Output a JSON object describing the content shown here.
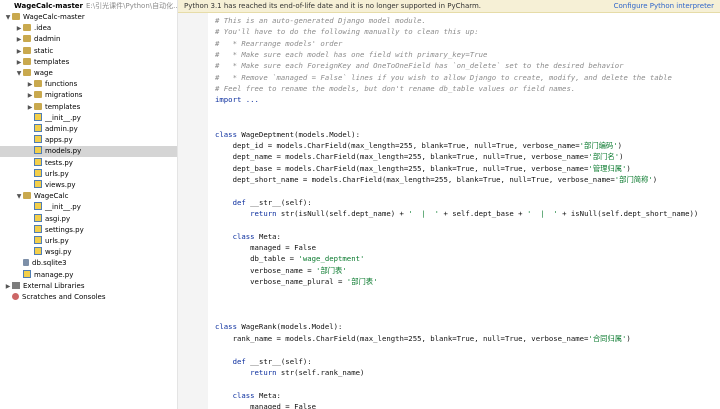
{
  "sidebar": {
    "project_name": "WageCalc-master",
    "project_path": "E:\\引光课件\\Python\\自动化...",
    "items": [
      {
        "label": "WageCalc-master",
        "level": 0,
        "type": "folder",
        "expanded": true,
        "icon": "folder-icon"
      },
      {
        "label": ".idea",
        "level": 1,
        "type": "folder",
        "expanded": false,
        "icon": "folder-icon"
      },
      {
        "label": "dadmin",
        "level": 1,
        "type": "folder",
        "expanded": false,
        "icon": "folder-icon"
      },
      {
        "label": "static",
        "level": 1,
        "type": "folder",
        "expanded": false,
        "icon": "folder-icon"
      },
      {
        "label": "templates",
        "level": 1,
        "type": "folder",
        "expanded": false,
        "icon": "folder-icon"
      },
      {
        "label": "wage",
        "level": 1,
        "type": "folder",
        "expanded": true,
        "icon": "folder-icon"
      },
      {
        "label": "functions",
        "level": 2,
        "type": "folder",
        "expanded": false,
        "icon": "folder-icon"
      },
      {
        "label": "migrations",
        "level": 2,
        "type": "folder",
        "expanded": false,
        "icon": "folder-icon"
      },
      {
        "label": "templates",
        "level": 2,
        "type": "folder",
        "expanded": false,
        "icon": "folder-icon"
      },
      {
        "label": "__init__.py",
        "level": 2,
        "type": "py",
        "icon": "python-file-icon"
      },
      {
        "label": "admin.py",
        "level": 2,
        "type": "py",
        "icon": "python-file-icon"
      },
      {
        "label": "apps.py",
        "level": 2,
        "type": "py",
        "icon": "python-file-icon"
      },
      {
        "label": "models.py",
        "level": 2,
        "type": "py",
        "icon": "python-file-icon",
        "selected": true
      },
      {
        "label": "tests.py",
        "level": 2,
        "type": "py",
        "icon": "python-file-icon"
      },
      {
        "label": "urls.py",
        "level": 2,
        "type": "py",
        "icon": "python-file-icon"
      },
      {
        "label": "views.py",
        "level": 2,
        "type": "py",
        "icon": "python-file-icon"
      },
      {
        "label": "WageCalc",
        "level": 1,
        "type": "folder",
        "expanded": true,
        "icon": "folder-icon"
      },
      {
        "label": "__init__.py",
        "level": 2,
        "type": "py",
        "icon": "python-file-icon"
      },
      {
        "label": "asgi.py",
        "level": 2,
        "type": "py",
        "icon": "python-file-icon"
      },
      {
        "label": "settings.py",
        "level": 2,
        "type": "py",
        "icon": "python-file-icon"
      },
      {
        "label": "urls.py",
        "level": 2,
        "type": "py",
        "icon": "python-file-icon"
      },
      {
        "label": "wsgi.py",
        "level": 2,
        "type": "py",
        "icon": "python-file-icon"
      },
      {
        "label": "db.sqlite3",
        "level": 1,
        "type": "db",
        "icon": "database-file-icon"
      },
      {
        "label": "manage.py",
        "level": 1,
        "type": "py",
        "icon": "python-file-icon"
      },
      {
        "label": "External Libraries",
        "level": 0,
        "type": "libs",
        "expanded": false,
        "icon": "libraries-icon"
      },
      {
        "label": "Scratches and Consoles",
        "level": 0,
        "type": "scratch",
        "icon": "scratches-icon"
      }
    ]
  },
  "banner": {
    "message": "Python 3.1 has reached its end-of-life date and it is no longer supported in PyCharm.",
    "link": "Configure Python interpreter",
    "bg_color": "#f6f0d6"
  },
  "editor": {
    "lines": [
      [
        [
          "c",
          "# This is an auto-generated Django model module."
        ]
      ],
      [
        [
          "c",
          "# You'll have to do the following manually to clean this up:"
        ]
      ],
      [
        [
          "c",
          "#   * Rearrange models' order"
        ]
      ],
      [
        [
          "c",
          "#   * Make sure each model has one field with primary_key=True"
        ]
      ],
      [
        [
          "c",
          "#   * Make sure each ForeignKey and OneToOneField has `on_delete` set to the desired behavior"
        ]
      ],
      [
        [
          "c",
          "#   * Remove `managed = False` lines if you wish to allow Django to create, modify, and delete the table"
        ]
      ],
      [
        [
          "c",
          "# Feel free to rename the models, but don't rename db_table values or field names."
        ]
      ],
      [
        [
          "k",
          "import ..."
        ]
      ],
      [],
      [],
      [
        [
          "k",
          "class "
        ],
        [
          "t",
          "WageDeptment(models.Model):"
        ]
      ],
      [
        [
          "t",
          "    dept_id = models.CharField(max_length=255, blank=True, null=True, verbose_name="
        ],
        [
          "s",
          "'部门编码'"
        ],
        [
          "t",
          ")"
        ]
      ],
      [
        [
          "t",
          "    dept_name = models.CharField(max_length=255, blank=True, null=True, verbose_name="
        ],
        [
          "s",
          "'部门名'"
        ],
        [
          "t",
          ")"
        ]
      ],
      [
        [
          "t",
          "    dept_base = models.CharField(max_length=255, blank=True, null=True, verbose_name="
        ],
        [
          "s",
          "'管理归属'"
        ],
        [
          "t",
          ")"
        ]
      ],
      [
        [
          "t",
          "    dept_short_name = models.CharField(max_length=255, blank=True, null=True, verbose_name="
        ],
        [
          "s",
          "'部门简称'"
        ],
        [
          "t",
          ")"
        ]
      ],
      [],
      [
        [
          "k",
          "    def "
        ],
        [
          "t",
          "__str__(self):"
        ]
      ],
      [
        [
          "k",
          "        return "
        ],
        [
          "t",
          "str(isNull(self.dept_name) + "
        ],
        [
          "s",
          "'  |  '"
        ],
        [
          "t",
          " + self.dept_base + "
        ],
        [
          "s",
          "'  |  '"
        ],
        [
          "t",
          " + isNull(self.dept_short_name))"
        ]
      ],
      [],
      [
        [
          "k",
          "    class "
        ],
        [
          "t",
          "Meta:"
        ]
      ],
      [
        [
          "t",
          "        managed = False"
        ]
      ],
      [
        [
          "t",
          "        db_table = "
        ],
        [
          "s",
          "'wage_deptment'"
        ]
      ],
      [
        [
          "t",
          "        verbose_name = "
        ],
        [
          "s",
          "'部门表'"
        ]
      ],
      [
        [
          "t",
          "        verbose_name_plural = "
        ],
        [
          "s",
          "'部门表'"
        ]
      ],
      [],
      [],
      [],
      [
        [
          "k",
          "class "
        ],
        [
          "t",
          "WageRank(models.Model):"
        ]
      ],
      [
        [
          "t",
          "    rank_name = models.CharField(max_length=255, blank=True, null=True, verbose_name="
        ],
        [
          "s",
          "'合同归属'"
        ],
        [
          "t",
          ")"
        ]
      ],
      [],
      [
        [
          "k",
          "    def "
        ],
        [
          "t",
          "__str__(self):"
        ]
      ],
      [
        [
          "k",
          "        return "
        ],
        [
          "t",
          "str(self.rank_name)"
        ]
      ],
      [],
      [
        [
          "k",
          "    class "
        ],
        [
          "t",
          "Meta:"
        ]
      ],
      [
        [
          "t",
          "        managed = False"
        ]
      ]
    ]
  }
}
